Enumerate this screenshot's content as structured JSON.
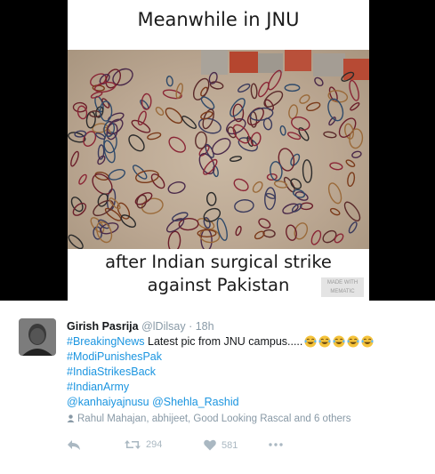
{
  "meme": {
    "top_caption": "Meanwhile in JNU",
    "bottom_caption_line1": "after Indian surgical strike",
    "bottom_caption_line2": "against Pakistan",
    "watermark_line1": "MADE WITH",
    "watermark_line2": "MEMATIC"
  },
  "tweet": {
    "author_name": "Girish Pasrija",
    "author_handle": "@lDilsay",
    "separator": "·",
    "time": "18h",
    "hashtag_breaking": "#BreakingNews",
    "line1_text": " Latest pic from JNU campus.....",
    "hashtag_modi": "#ModiPunishesPak",
    "hashtag_india": "#IndiaStrikesBack",
    "hashtag_army": "#IndianArmy",
    "mention_1": "@kanhaiyajnusu",
    "mention_2": "@Shehla_Rashid",
    "liked_by": "Rahul Mahajan, abhijeet, Good Looking Rascal and 6 others",
    "emoji_icon": "face-with-tears-of-joy",
    "emoji_count": 5,
    "retweet_count": "294",
    "like_count": "581"
  },
  "colors": {
    "link": "#1b95e0",
    "muted": "#8899a6",
    "action": "#aab8c2"
  }
}
